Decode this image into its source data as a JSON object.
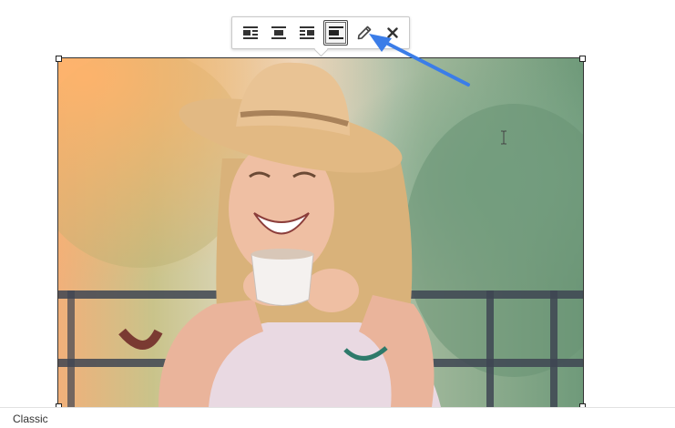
{
  "toolbar": {
    "buttons": [
      {
        "name": "align-left",
        "icon": "align-left-icon"
      },
      {
        "name": "align-center",
        "icon": "align-center-icon"
      },
      {
        "name": "align-right",
        "icon": "align-right-icon"
      },
      {
        "name": "align-none",
        "icon": "align-none-icon",
        "active": true
      },
      {
        "name": "edit",
        "icon": "pencil-icon"
      },
      {
        "name": "remove",
        "icon": "close-icon"
      }
    ]
  },
  "annotation": {
    "color": "#3b7de8",
    "points_to": "edit"
  },
  "status_bar": {
    "label": "Classic"
  },
  "colors": {
    "accent": "#3b7de8",
    "border": "#c9c9c9",
    "text": "#333333"
  }
}
